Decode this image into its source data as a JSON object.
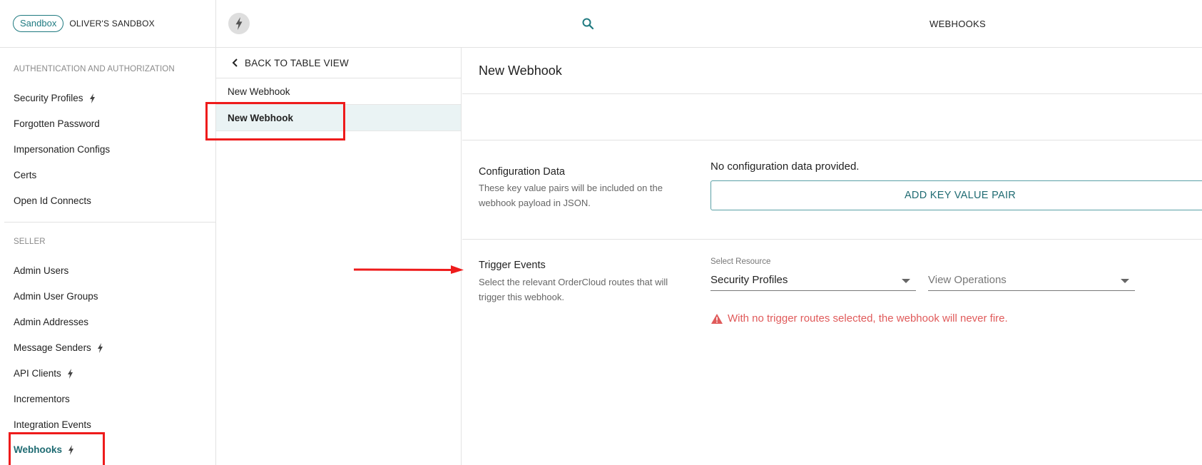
{
  "sidebar": {
    "env_pill": "Sandbox",
    "org_name": "OLIVER'S SANDBOX",
    "section_auth": "AUTHENTICATION AND AUTHORIZATION",
    "auth_items": [
      {
        "label": "Security Profiles",
        "bolt": true
      },
      {
        "label": "Forgotten Password",
        "bolt": false
      },
      {
        "label": "Impersonation Configs",
        "bolt": false
      },
      {
        "label": "Certs",
        "bolt": false
      },
      {
        "label": "Open Id Connects",
        "bolt": false
      }
    ],
    "section_seller": "SELLER",
    "seller_items": [
      {
        "label": "Admin Users",
        "bolt": false
      },
      {
        "label": "Admin User Groups",
        "bolt": false
      },
      {
        "label": "Admin Addresses",
        "bolt": false
      },
      {
        "label": "Message Senders",
        "bolt": true
      },
      {
        "label": "API Clients",
        "bolt": true
      },
      {
        "label": "Incrementors",
        "bolt": false
      },
      {
        "label": "Integration Events",
        "bolt": false
      },
      {
        "label": "Webhooks",
        "bolt": true,
        "active": true
      }
    ]
  },
  "topbar": {
    "title": "WEBHOOKS",
    "search_icon": "search-icon",
    "avatar_icon": "bolt-icon"
  },
  "list": {
    "back_label": "BACK TO TABLE VIEW",
    "items": [
      {
        "label": "New Webhook",
        "selected": false
      },
      {
        "label": "New Webhook",
        "selected": true
      }
    ]
  },
  "detail": {
    "title": "New Webhook",
    "config": {
      "label": "Configuration Data",
      "description": "These key value pairs will be included on the webhook payload in JSON.",
      "empty_text": "No configuration data provided.",
      "add_button": "ADD KEY VALUE PAIR"
    },
    "trigger": {
      "label": "Trigger Events",
      "description": "Select the relevant OrderCloud routes that will trigger this webhook.",
      "resource_caption": "Select Resource",
      "resource_value": "Security Profiles",
      "operations_placeholder": "View Operations",
      "warning": "With no trigger routes selected, the webhook will never fire."
    }
  },
  "colors": {
    "accent": "#1f6b72",
    "warning": "#e05a5a",
    "annotation": "#ee1b1b",
    "selected_bg": "#eaf3f4"
  }
}
